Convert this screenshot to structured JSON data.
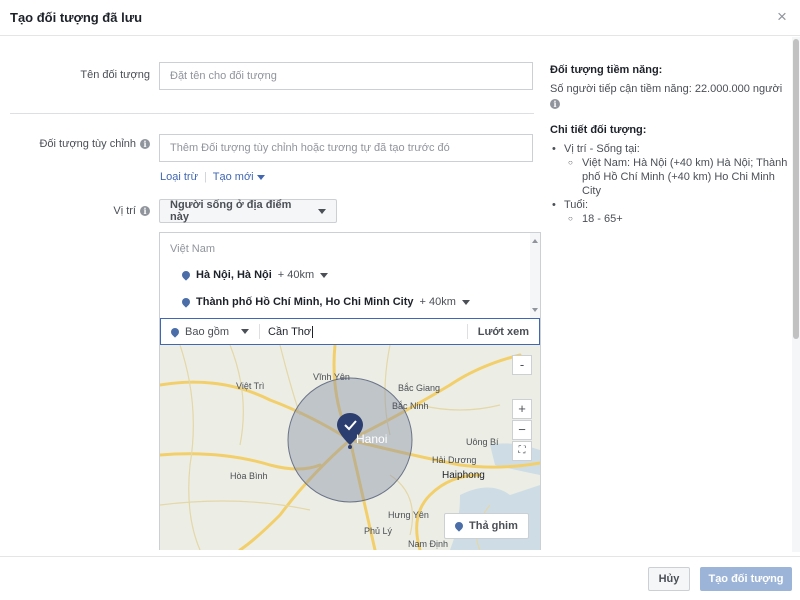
{
  "dialog": {
    "title": "Tạo đối tượng đã lưu",
    "close_icon": "×"
  },
  "form": {
    "audience_name": {
      "label": "Tên đối tượng",
      "placeholder": "Đặt tên cho đối tượng"
    },
    "custom_audience": {
      "label": "Đối tượng tùy chỉnh",
      "placeholder": "Thêm Đối tượng tùy chỉnh hoặc tương tự đã tạo trước đó",
      "exclude_link": "Loại trừ",
      "create_new_link": "Tạo mới"
    },
    "location": {
      "label": "Vị trí",
      "type_button": "Người sống ở địa điểm này",
      "country": "Việt Nam",
      "items": [
        {
          "name": "Hà Nội, Hà Nội",
          "radius": "+ 40km"
        },
        {
          "name": "Thành phố Hồ Chí Minh, Ho Chi Minh City",
          "radius": "+ 40km"
        }
      ],
      "include_mode": "Bao gồm",
      "search_value": "Cần Thơ",
      "browse_label": "Lướt xem",
      "drop_pin_label": "Thả ghim",
      "map_labels": [
        "Việt Trì",
        "Vĩnh Yên",
        "Bắc Giang",
        "Bắc Ninh",
        "Hanoi",
        "Uông Bí",
        "Hải Dương",
        "Haiphong",
        "Hòa Bình",
        "Hưng Yên",
        "Phủ Lý",
        "Nam Định"
      ],
      "zoom_in": "+",
      "zoom_out": "−",
      "minimize": "-"
    }
  },
  "sidebar": {
    "potential_heading": "Đối tượng tiềm năng:",
    "potential_reach": "Số người tiếp cận tiềm năng: 22.000.000 người",
    "details_heading": "Chi tiết đối tượng:",
    "location_label": "Vị trí - Sống tại:",
    "location_value": "Việt Nam: Hà Nội (+40 km) Hà Nội; Thành phố Hồ Chí Minh (+40 km) Ho Chi Minh City",
    "age_label": "Tuổi:",
    "age_value": "18 - 65+"
  },
  "footer": {
    "cancel_label": "Hủy",
    "create_label": "Tạo đối tượng"
  },
  "icons": {
    "info": "info-icon",
    "pin": "location-pin-icon",
    "check_pin": "check-pin-icon"
  },
  "colors": {
    "link": "#4267b2",
    "primary_disabled": "#9cb4d8",
    "radius_fill": "#8b93a8"
  }
}
